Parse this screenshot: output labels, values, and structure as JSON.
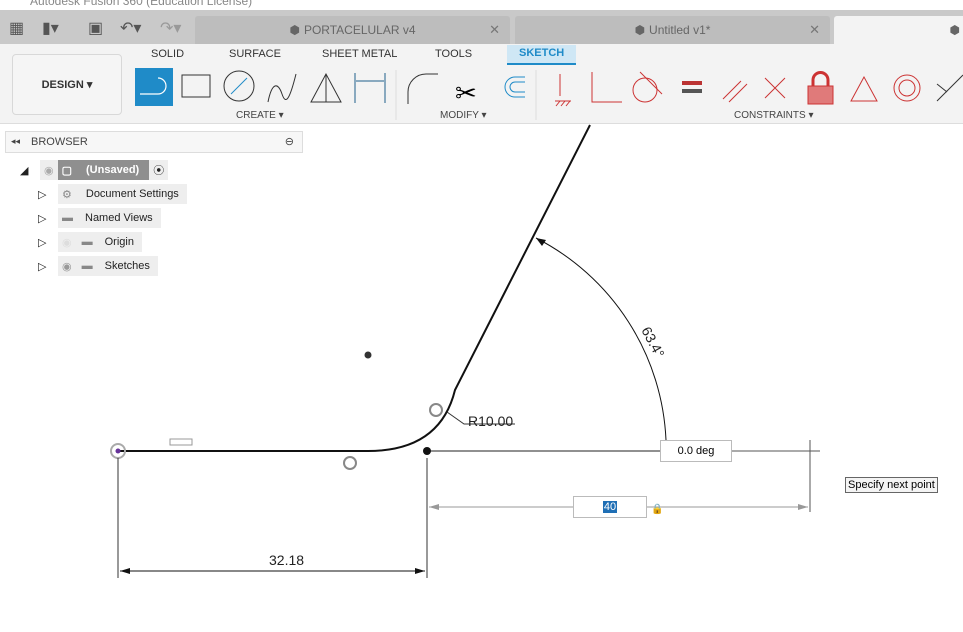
{
  "window": {
    "title": "Autodesk Fusion 360 (Education License)"
  },
  "tabs": [
    {
      "label": "PORTACELULAR v4"
    },
    {
      "label": "Untitled v1*"
    }
  ],
  "ribbon": {
    "workspace": "DESIGN",
    "tabs": [
      "SOLID",
      "SURFACE",
      "SHEET METAL",
      "TOOLS",
      "SKETCH"
    ],
    "active_tab": "SKETCH",
    "groups": {
      "create": "CREATE",
      "modify": "MODIFY",
      "constraints": "CONSTRAINTS"
    },
    "accent": "#1f8bc8"
  },
  "browser": {
    "title": "BROWSER",
    "root": "(Unsaved)",
    "items": [
      {
        "label": "Document Settings"
      },
      {
        "label": "Named Views"
      },
      {
        "label": "Origin"
      },
      {
        "label": "Sketches"
      }
    ]
  },
  "sketch": {
    "radius_label": "R10.00",
    "angle_label": "63.4°",
    "length_label": "32.18",
    "angle_input": "0.0 deg",
    "length_input": "40",
    "tooltip": "Specify next point"
  }
}
